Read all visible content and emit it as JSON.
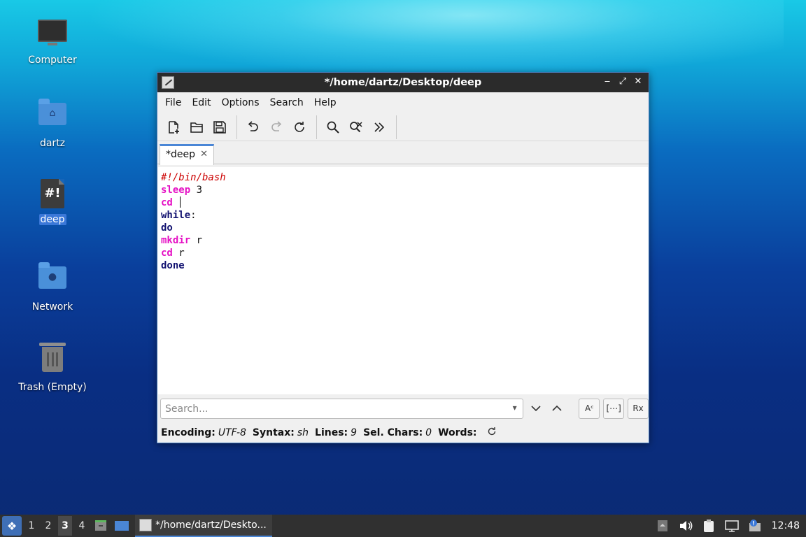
{
  "desktop": {
    "icons": [
      {
        "label": "Computer",
        "icon": "computer-icon"
      },
      {
        "label": "dartz",
        "icon": "home-folder-icon"
      },
      {
        "label": "deep",
        "icon": "script-file-icon",
        "glyph": "#!"
      },
      {
        "label": "Network",
        "icon": "network-folder-icon"
      },
      {
        "label": "Trash (Empty)",
        "icon": "trash-icon"
      }
    ]
  },
  "window": {
    "title": "*/home/dartz/Desktop/deep",
    "controls": {
      "minimize": "‒",
      "maximize": "⤢",
      "close": "✕"
    },
    "menu": [
      "File",
      "Edit",
      "Options",
      "Search",
      "Help"
    ],
    "toolbar": [
      "new-file",
      "open-file",
      "save",
      "undo",
      "redo",
      "reload",
      "find",
      "find-replace",
      "more"
    ],
    "tab": {
      "label": "*deep",
      "close": "✕"
    },
    "editor": {
      "lines": [
        {
          "parts": [
            {
              "t": "#!/bin/bash",
              "c": "comment"
            }
          ]
        },
        {
          "parts": [
            {
              "t": "sleep",
              "c": "cmd"
            },
            {
              "t": " 3",
              "c": "plain"
            }
          ]
        },
        {
          "parts": [
            {
              "t": "cd",
              "c": "cmd"
            },
            {
              "t": " ",
              "c": "plain"
            }
          ],
          "caret": true
        },
        {
          "parts": [
            {
              "t": "while",
              "c": "kw"
            },
            {
              "t": ":",
              "c": "plain"
            }
          ]
        },
        {
          "parts": [
            {
              "t": "do",
              "c": "kw"
            }
          ]
        },
        {
          "parts": [
            {
              "t": "mkdir",
              "c": "cmd"
            },
            {
              "t": " r",
              "c": "plain"
            }
          ]
        },
        {
          "parts": [
            {
              "t": "cd",
              "c": "cmd"
            },
            {
              "t": " r",
              "c": "plain"
            }
          ]
        },
        {
          "parts": [
            {
              "t": "done",
              "c": "kw"
            }
          ]
        }
      ]
    },
    "find": {
      "placeholder": "Search...",
      "down": "⌄",
      "up": "⌃",
      "case": "Aᶜ",
      "whole": "[⋯]",
      "regex": "Rx"
    },
    "status": {
      "encoding_label": "Encoding:",
      "encoding": "UTF-8",
      "syntax_label": "Syntax:",
      "syntax": "sh",
      "lines_label": "Lines:",
      "lines": "9",
      "sel_label": "Sel. Chars:",
      "sel": "0",
      "words_label": "Words:"
    }
  },
  "taskbar": {
    "workspaces": [
      "1",
      "2",
      "3",
      "4"
    ],
    "active_workspace": "3",
    "task": "*/home/dartz/Deskto...",
    "clock": "12:48"
  }
}
